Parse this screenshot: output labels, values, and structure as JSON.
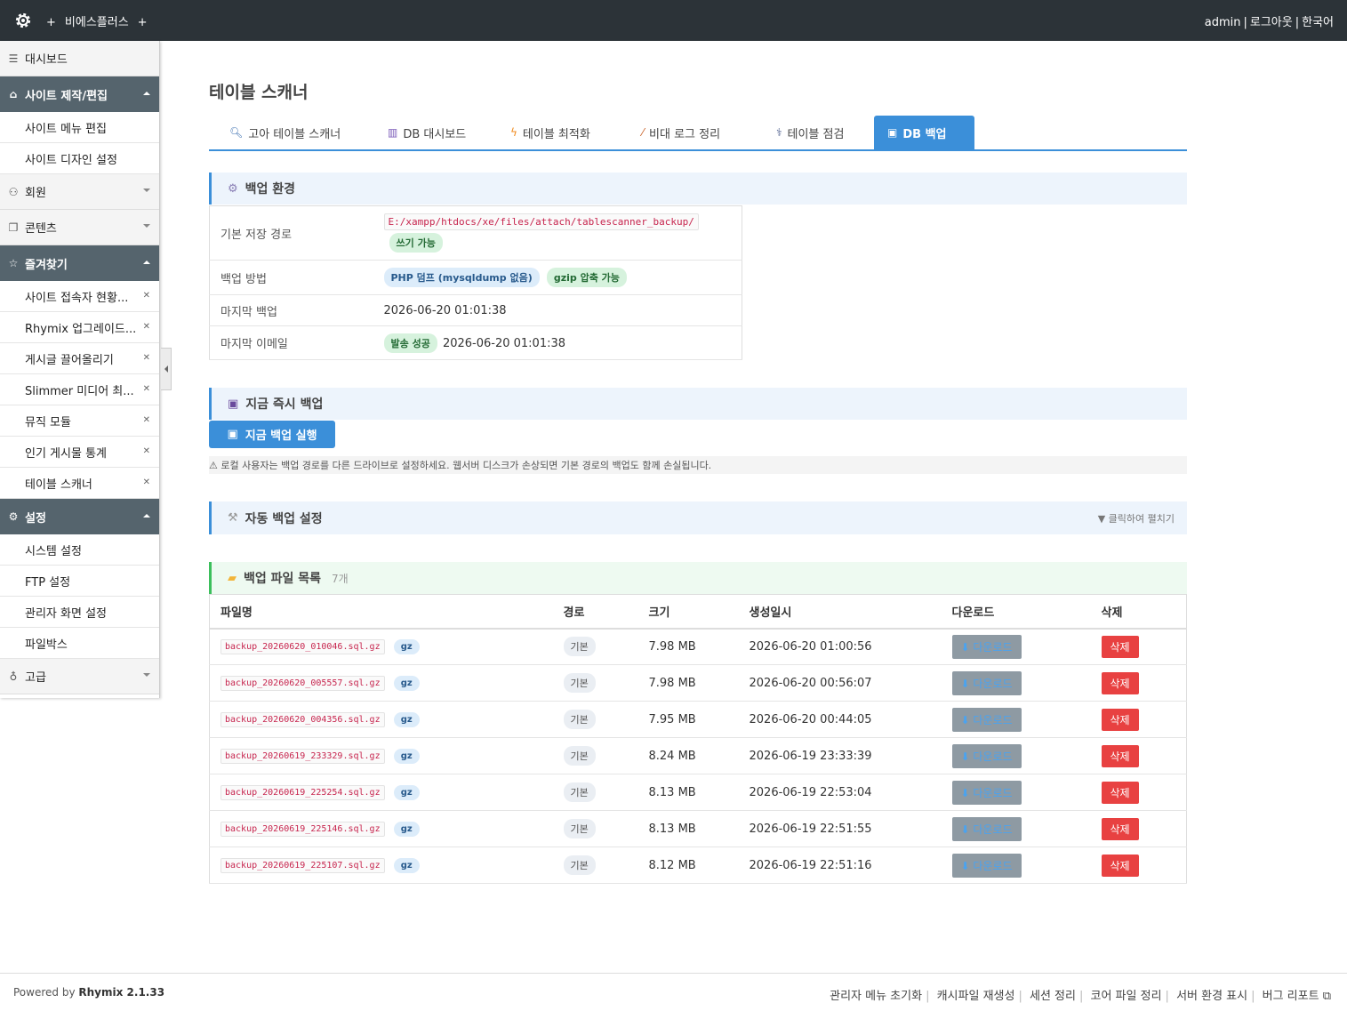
{
  "topbar": {
    "brand_plus_left": "+",
    "brand": "비에스플러스",
    "brand_plus_right": "+",
    "user": "admin",
    "logout": "로그아웃",
    "language": "한국어",
    "accent": "#2c3338"
  },
  "sidebar": {
    "dashboard": "대시보드",
    "site": {
      "label": "사이트 제작/편집",
      "items": [
        "사이트 메뉴 편집",
        "사이트 디자인 설정"
      ]
    },
    "member": "회원",
    "content": "콘텐츠",
    "favorites": {
      "label": "즐겨찾기",
      "items": [
        "사이트 접속자 현황...",
        "Rhymix 업그레이드...",
        "게시글 끌어올리기",
        "Slimmer 미디어 최...",
        "뮤직 모듈",
        "인기 게시물 통계",
        "테이블 스캐너"
      ]
    },
    "settings": {
      "label": "설정",
      "items": [
        "시스템 설정",
        "FTP 설정",
        "관리자 화면 설정",
        "파일박스"
      ]
    },
    "advanced": "고급"
  },
  "page": {
    "title": "테이블 스캐너"
  },
  "tabs": [
    {
      "label": "고아 테이블 스캐너",
      "icon": "search-icon"
    },
    {
      "label": "DB 대시보드",
      "icon": "chart-icon"
    },
    {
      "label": "테이블 최적화",
      "icon": "bolt-icon"
    },
    {
      "label": "비대 로그 정리",
      "icon": "broom-icon"
    },
    {
      "label": "테이블 점검",
      "icon": "stethoscope-icon"
    },
    {
      "label": "DB 백업",
      "icon": "floppy-icon",
      "active": true
    }
  ],
  "env": {
    "title": "백업 환경",
    "path_label": "기본 저장 경로",
    "path": "E:/xampp/htdocs/xe/files/attach/tablescanner_backup/",
    "path_status": "쓰기 가능",
    "method_label": "백업 방법",
    "method1": "PHP 덤프 (mysqldump 없음)",
    "method2": "gzip 압축 가능",
    "last_backup_label": "마지막 백업",
    "last_backup": "2026-06-20 01:01:38",
    "last_email_label": "마지막 이메일",
    "last_email_status": "발송 성공",
    "last_email": "2026-06-20 01:01:38"
  },
  "instant": {
    "title": "지금 즉시 백업",
    "button": "지금 백업 실행",
    "warning": "⚠ 로컬 사용자는 백업 경로를 다른 드라이브로 설정하세요. 웹서버 디스크가 손상되면 기본 경로의 백업도 함께 손실됩니다."
  },
  "auto": {
    "title": "자동 백업 설정",
    "toggle": "▼ 클릭하여 펼치기"
  },
  "files": {
    "title": "백업 파일 목록",
    "count": "7개",
    "headers": [
      "파일명",
      "경로",
      "크기",
      "생성일시",
      "다운로드",
      "삭제"
    ],
    "download_label": "⬇ 다운로드",
    "delete_label": "삭제",
    "rows": [
      {
        "name": "backup_20260620_010046.sql.gz",
        "type": "gz",
        "path": "기본",
        "size": "7.98 MB",
        "date": "2026-06-20 01:00:56"
      },
      {
        "name": "backup_20260620_005557.sql.gz",
        "type": "gz",
        "path": "기본",
        "size": "7.98 MB",
        "date": "2026-06-20 00:56:07"
      },
      {
        "name": "backup_20260620_004356.sql.gz",
        "type": "gz",
        "path": "기본",
        "size": "7.95 MB",
        "date": "2026-06-20 00:44:05"
      },
      {
        "name": "backup_20260619_233329.sql.gz",
        "type": "gz",
        "path": "기본",
        "size": "8.24 MB",
        "date": "2026-06-19 23:33:39"
      },
      {
        "name": "backup_20260619_225254.sql.gz",
        "type": "gz",
        "path": "기본",
        "size": "8.13 MB",
        "date": "2026-06-19 22:53:04"
      },
      {
        "name": "backup_20260619_225146.sql.gz",
        "type": "gz",
        "path": "기본",
        "size": "8.13 MB",
        "date": "2026-06-19 22:51:55"
      },
      {
        "name": "backup_20260619_225107.sql.gz",
        "type": "gz",
        "path": "기본",
        "size": "8.12 MB",
        "date": "2026-06-19 22:51:16"
      }
    ]
  },
  "footer": {
    "powered": "Powered by",
    "product": "Rhymix 2.1.33",
    "links": [
      "관리자 메뉴 초기화",
      "캐시파일 재생성",
      "세션 정리",
      "코어 파일 정리",
      "서버 환경 표시",
      "버그 리포트"
    ]
  }
}
